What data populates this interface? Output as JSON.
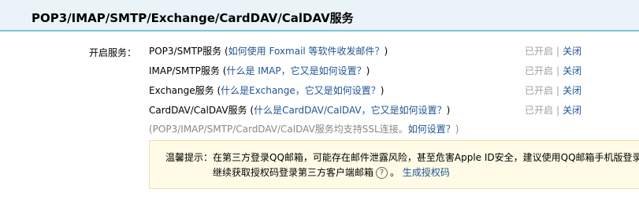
{
  "header": {
    "title": "POP3/IMAP/SMTP/Exchange/CardDAV/CalDAV服务"
  },
  "services_label": "开启服务：",
  "services": [
    {
      "name": "POP3/SMTP服务",
      "open": "(",
      "link": "如何使用 Foxmail 等软件收发邮件？",
      "close": ")",
      "status_on": "已开启",
      "sep": "|",
      "action": "关闭"
    },
    {
      "name": "IMAP/SMTP服务",
      "open": "(",
      "link": "什么是 IMAP，它又是如何设置？",
      "close": ")",
      "status_on": "已开启",
      "sep": "|",
      "action": "关闭"
    },
    {
      "name": "Exchange服务",
      "open": "(",
      "link": "什么是Exchange，它又是如何设置？",
      "close": ")",
      "status_on": "已开启",
      "sep": "|",
      "action": "关闭"
    },
    {
      "name": "CardDAV/CalDAV服务",
      "open": "(",
      "link": "什么是CardDAV/CalDAV，它又是如何设置？",
      "close": ")",
      "status_on": "已开启",
      "sep": "|",
      "action": "关闭"
    }
  ],
  "ssl_note": {
    "prefix": "(POP3/IMAP/SMTP/CardDAV/CalDAV服务均支持SSL连接。",
    "link": "如何设置？",
    "suffix": ")"
  },
  "notice": {
    "label": "温馨提示：",
    "line1": "在第三方登录QQ邮箱，可能存在邮件泄露风险，甚至危害Apple ID安全，建议使用QQ邮箱手机版登录",
    "line2_prefix": "继续获取授权码登录第三方客户端邮箱",
    "help_icon": "?",
    "link": "生成授权码"
  }
}
